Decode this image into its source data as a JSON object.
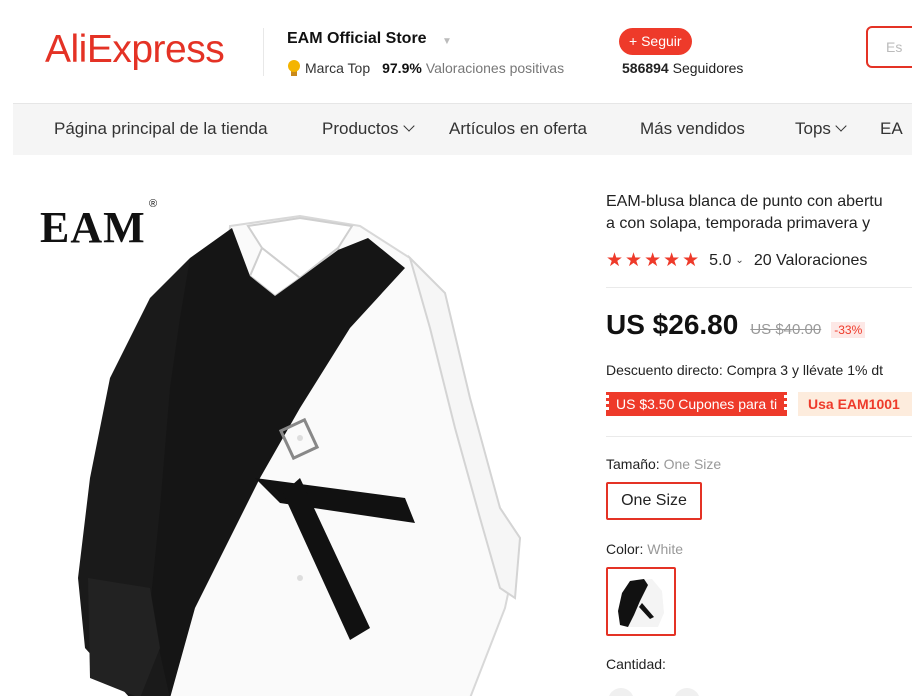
{
  "header": {
    "logo": "AliExpress",
    "store_name": "EAM Official Store",
    "badge_label": "Marca Top",
    "positive_pct": "97.9%",
    "positive_label": "Valoraciones positivas",
    "follow_label": "+ Seguir",
    "followers_count": "586894",
    "followers_label": "Seguidores",
    "search_placeholder": "Es"
  },
  "nav": {
    "items": [
      {
        "label": "Página principal de la tienda"
      },
      {
        "label": "Productos"
      },
      {
        "label": "Artículos en oferta"
      },
      {
        "label": "Más vendidos"
      },
      {
        "label": "Tops"
      },
      {
        "label": "EA"
      }
    ]
  },
  "product": {
    "brand_mark": "EAM",
    "brand_reg": "®",
    "title_line1": "EAM-blusa blanca de punto con abertu",
    "title_line2": "a con solapa, temporada primavera y",
    "stars": "★★★★★",
    "rating": "5.0",
    "reviews": "20 Valoraciones",
    "price_now": "US $26.80",
    "price_old": "US $40.00",
    "discount_pct": "-33%",
    "discount_text": "Descuento directo: Compra 3 y llévate 1% dt",
    "coupon_label": "US $3.50 Cupones para ti",
    "promo_label": "Usa EAM1001",
    "size_label": "Tamaño:",
    "size_value": "One Size",
    "size_option": "One Size",
    "color_label": "Color:",
    "color_value": "White",
    "qty_label": "Cantidad:"
  },
  "colors": {
    "brand": "#e43225",
    "accent": "#ee3a2a"
  }
}
